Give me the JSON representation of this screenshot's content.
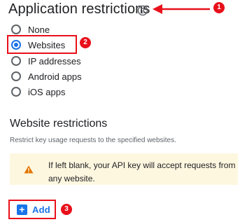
{
  "header": {
    "title": "Application restrictions",
    "help_icon": "help-circle-icon"
  },
  "annotations": {
    "badge_1": "1",
    "badge_2": "2",
    "badge_3": "3",
    "highlight_color": "#e8101b"
  },
  "restriction_options": [
    {
      "label": "None",
      "selected": false
    },
    {
      "label": "Websites",
      "selected": true
    },
    {
      "label": "IP addresses",
      "selected": false
    },
    {
      "label": "Android apps",
      "selected": false
    },
    {
      "label": "iOS apps",
      "selected": false
    }
  ],
  "website_restrictions": {
    "title": "Website restrictions",
    "description": "Restrict key usage requests to the specified websites.",
    "warning": "If left blank, your API key will accept requests from any website.",
    "warning_icon": "warning-triangle-icon",
    "add_label": "Add",
    "add_icon": "plus-box-icon"
  },
  "colors": {
    "accent": "#1a73e8",
    "warning_bg": "#fef7e0",
    "warning_icon": "#e37400"
  }
}
